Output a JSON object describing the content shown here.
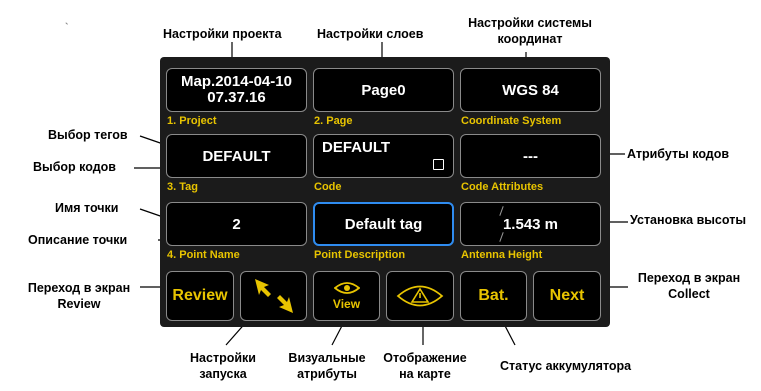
{
  "fields": {
    "project": {
      "value_line1": "Map.2014-04-10",
      "value_line2": "07.37.16",
      "label": "1. Project"
    },
    "page": {
      "value": "Page0",
      "label": "2. Page"
    },
    "coord": {
      "value": "WGS 84",
      "label": "Coordinate System"
    },
    "tag": {
      "value": "DEFAULT",
      "label": "3. Tag"
    },
    "code": {
      "value": "DEFAULT",
      "label": "Code"
    },
    "code_attr": {
      "value": "---",
      "label": "Code Attributes"
    },
    "point_name": {
      "value": "2",
      "label": "4. Point Name"
    },
    "point_desc": {
      "value": "Default tag",
      "label": "Point Description"
    },
    "antenna": {
      "value": "1.543 m",
      "label": "Antenna Height"
    }
  },
  "buttons": {
    "review": "Review",
    "view": "View",
    "bat": "Bat.",
    "next": "Next"
  },
  "annotations": {
    "project_settings": "Настройки проекта",
    "layer_settings": "Настройки слоев",
    "coord_settings_1": "Настройки системы",
    "coord_settings_2": "координат",
    "tag_select": "Выбор тегов",
    "code_select": "Выбор кодов",
    "code_attrs": "Атрибуты кодов",
    "point_name": "Имя точки",
    "point_desc": "Описание точки",
    "height_set": "Установка высоты",
    "review_1": "Переход в экран",
    "review_2": "Review",
    "collect_1": "Переход в экран",
    "collect_2": "Collect",
    "startup_1": "Настройки",
    "startup_2": "запуска",
    "visual_1": "Визуальные",
    "visual_2": "атрибуты",
    "map_1": "Отображение",
    "map_2": "на карте",
    "battery": "Статус аккумулятора"
  },
  "colors": {
    "accent_yellow": "#e8c400",
    "selection_blue": "#2f8cf0",
    "panel": "#1b1b1b"
  },
  "icons": [
    "checkbox-icon",
    "arrows-icon",
    "eye-icon",
    "warning-triangle-icon"
  ]
}
